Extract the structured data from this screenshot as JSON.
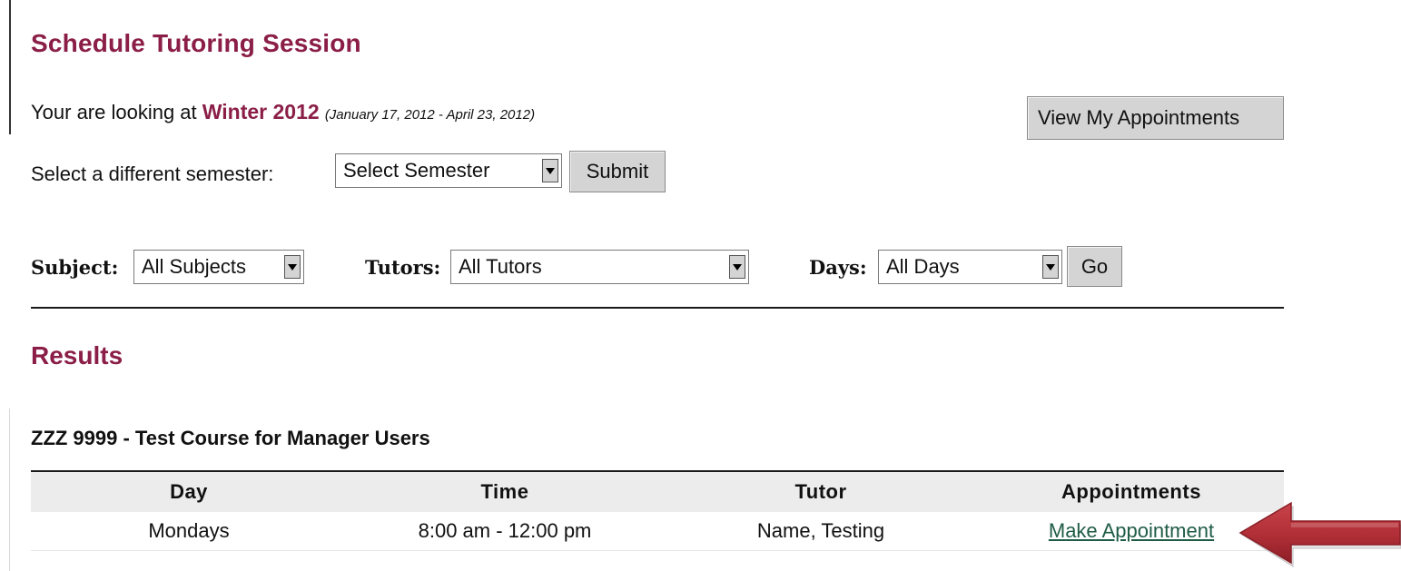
{
  "page": {
    "title": "Schedule Tutoring Session"
  },
  "semester": {
    "prefix": "Your are looking at",
    "name": "Winter 2012",
    "dates": "(January 17, 2012 - April 23, 2012)",
    "view_appointments_label": "View My Appointments",
    "select_label": "Select a different semester:",
    "select_value": "Select Semester",
    "submit_label": "Submit"
  },
  "filters": {
    "subject_label": "Subject:",
    "subject_value": "All Subjects",
    "tutors_label": "Tutors:",
    "tutors_value": "All Tutors",
    "days_label": "Days:",
    "days_value": "All Days",
    "go_label": "Go"
  },
  "results": {
    "heading": "Results",
    "course_title": "ZZZ 9999 - Test Course for Manager Users",
    "columns": [
      "Day",
      "Time",
      "Tutor",
      "Appointments"
    ],
    "rows": [
      {
        "day": "Mondays",
        "time": "8:00 am - 12:00 pm",
        "tutor": "Name, Testing",
        "appointment_link": "Make Appointment"
      }
    ]
  },
  "colors": {
    "accent": "#8b1e47",
    "link": "#1f5c46",
    "arrow": "#b8323a"
  },
  "icons": {
    "dropdown": "chevron-down-icon",
    "pointer": "right-arrow-pointer-icon"
  }
}
